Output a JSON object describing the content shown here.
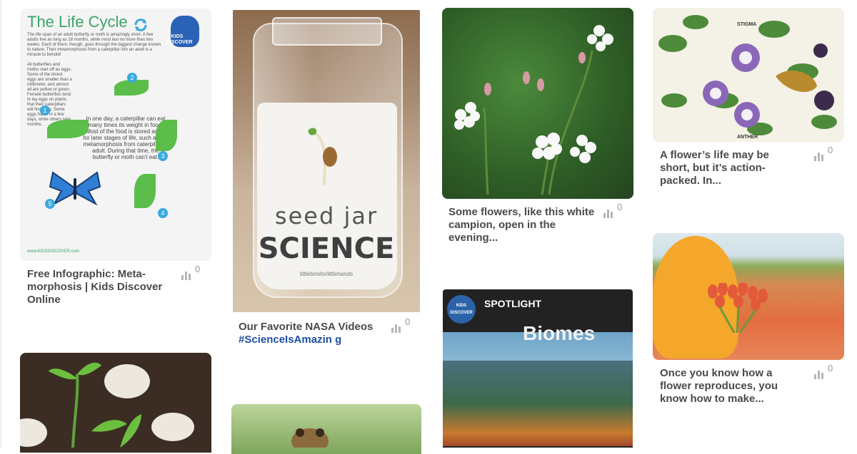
{
  "pins": {
    "lifecycle": {
      "title": "The Life Cycle",
      "intro": "The life span of an adult butterfly or moth is amazingly short. A few adults live as long as 18 months, while most last no more than two weeks. Each of them, though, goes through the biggest change known to nature: Their metamorphosis from a caterpillar into an adult is a miracle to behold!",
      "egg_text": "All butterflies and moths start off as eggs. Some of the tiniest eggs are smaller than a millimeter, and almost all are yellow or green. Female butterflies tend to lay eggs on plants that their caterpillars will find tasty. Some eggs hatch in a few days, while others take months.",
      "center_text": "In one day, a caterpillar can eat many times its weight in food. Most of the food is stored as fat for later stages of life, such as the metamorphosis from caterpillar to adult. During that time, the butterfly or moth can't eat.",
      "logo_text": "KIDS DISCOVER",
      "footer_url": "www.KIDSDISCOVER.com",
      "numbers": [
        "1",
        "2",
        "3",
        "4",
        "5"
      ],
      "caption": "Free Infographic: Meta-morphosis | Kids Discover Online",
      "count": "0"
    },
    "seedjar": {
      "line1": "seed jar",
      "line2": "SCIENCE",
      "line3": "littlebinsforlittlehands",
      "caption_main": "Our Favorite NASA Videos ",
      "caption_hashtag": "#ScienceIsAmazin g",
      "count": "0"
    },
    "campion": {
      "caption": "Some flowers, like this white campion, open in the evening...",
      "count": "0"
    },
    "biomes": {
      "spotlight": "SPOTLIGHT",
      "title": "Biomes",
      "logo_text": "KIDS DISCOVER"
    },
    "passion": {
      "label_top": "STIGMA",
      "label_bottom": "ANTHER",
      "caption": "A flower’s life may be short, but it’s action-packed. In...",
      "count": "0"
    },
    "tulips": {
      "caption": "Once you know how a flower reproduces, you know how to make...",
      "count": "0"
    }
  },
  "icons": {
    "stats": "bar-chart-icon"
  },
  "colors": {
    "caption_text": "#4a4a4a",
    "hashtag": "#1f4fa0",
    "lifecycle_title": "#3aa56a"
  }
}
